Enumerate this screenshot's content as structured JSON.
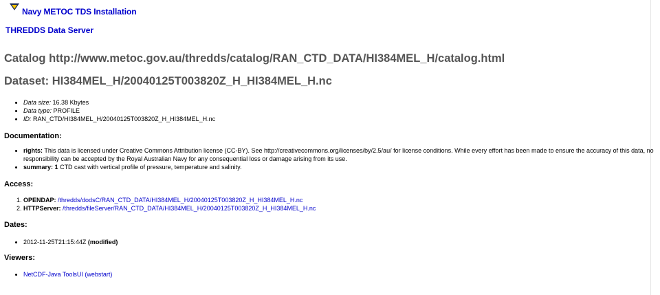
{
  "header": {
    "logo_icon": "triangle-logo-icon",
    "host_label": "Navy METOC TDS Installation",
    "server_label": "THREDDS Data Server"
  },
  "catalog_title": "Catalog http://www.metoc.gov.au/thredds/catalog/RAN_CTD_DATA/HI384MEL_H/catalog.html",
  "dataset_title": "Dataset: HI384MEL_H/20040125T003820Z_H_HI384MEL_H.nc",
  "properties": [
    {
      "key": "Data size:",
      "value": "16.38 Kbytes"
    },
    {
      "key": "Data type:",
      "value": "PROFILE"
    },
    {
      "key": "ID:",
      "value": "RAN_CTD/HI384MEL_H/20040125T003820Z_H_HI384MEL_H.nc"
    }
  ],
  "documentation": {
    "heading": "Documentation:",
    "items": [
      {
        "key": "rights:",
        "value": "This data is licensed under Creative Commons Attribution license (CC-BY). See http://creativecommons.org/licenses/by/2.5/au/ for license conditions. While every effort has been made to ensure the accuracy of this data, no responsibility can be accepted by the Royal Australian Navy for any consequential loss or damage arising from its use."
      },
      {
        "key": "summary:",
        "value_bold": "1",
        "value": " CTD cast with vertical profile of pressure, temperature and salinity."
      }
    ]
  },
  "access": {
    "heading": "Access:",
    "items": [
      {
        "service": "OPENDAP:",
        "url": "/thredds/dodsC/RAN_CTD_DATA/HI384MEL_H/20040125T003820Z_H_HI384MEL_H.nc"
      },
      {
        "service": "HTTPServer:",
        "url": "/thredds/fileServer/RAN_CTD_DATA/HI384MEL_H/20040125T003820Z_H_HI384MEL_H.nc"
      }
    ]
  },
  "dates": {
    "heading": "Dates:",
    "items": [
      {
        "value": "2012-11-25T21:15:44Z",
        "type": "(modified)"
      }
    ]
  },
  "viewers": {
    "heading": "Viewers:",
    "items": [
      {
        "label": "NetCDF-Java ToolsUI (webstart)"
      }
    ]
  },
  "colors": {
    "link": "#0000cc",
    "title_grey": "#555555",
    "logo_yellow": "#f2c200",
    "logo_navy": "#1a2a5a"
  }
}
